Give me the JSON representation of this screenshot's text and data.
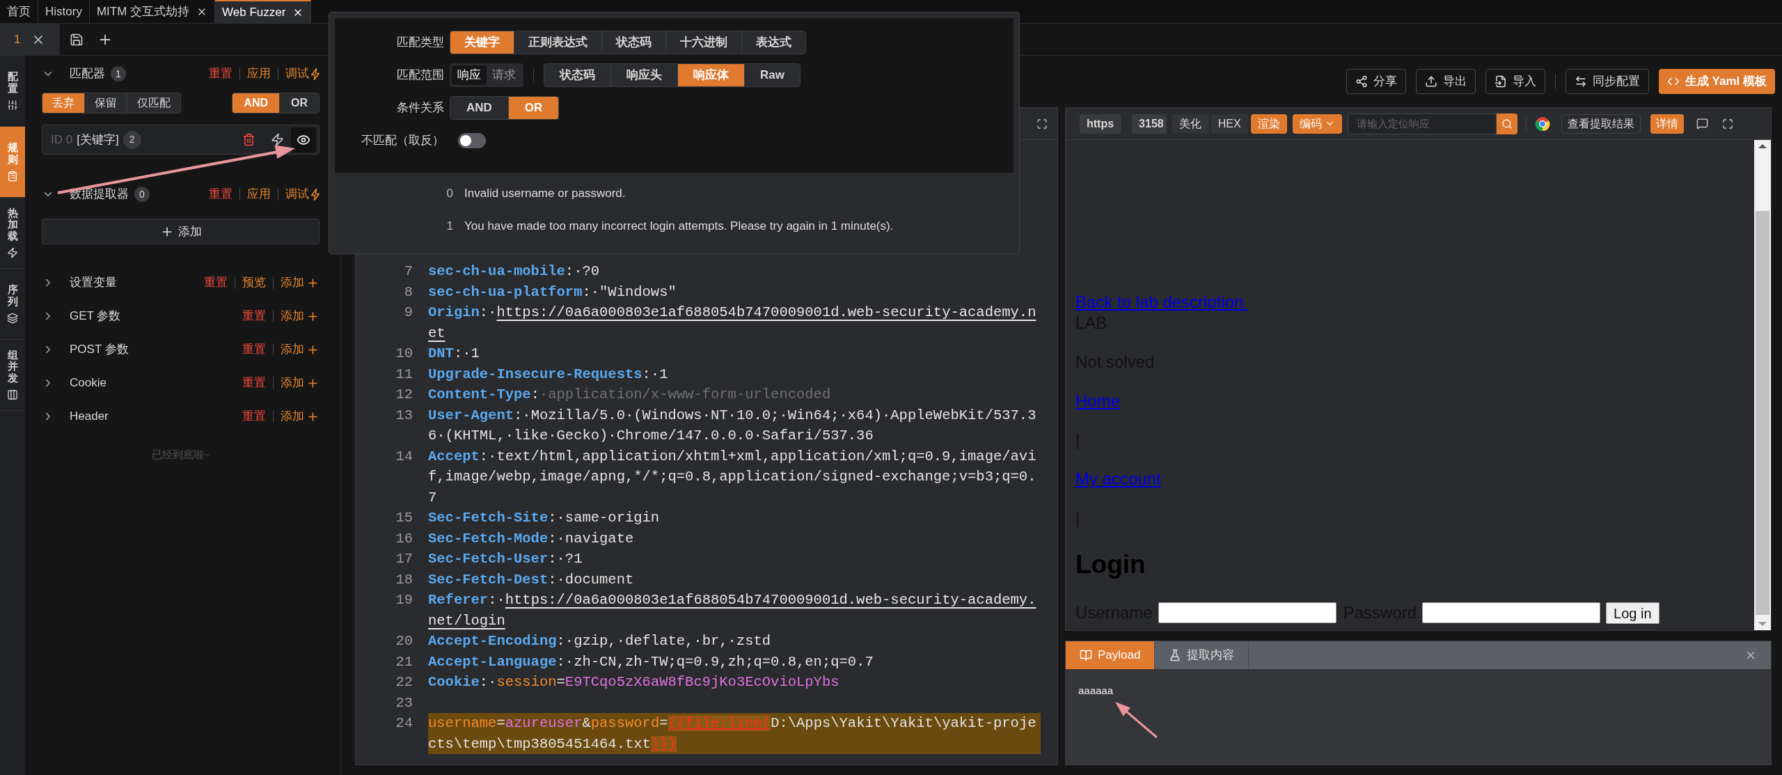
{
  "tabs": [
    {
      "label": "首页",
      "selected": false,
      "closable": false
    },
    {
      "label": "History",
      "selected": false,
      "closable": false
    },
    {
      "label": "MITM 交互式劫持",
      "selected": false,
      "closable": true
    },
    {
      "label": "Web Fuzzer",
      "selected": true,
      "closable": true
    }
  ],
  "sub_tab": {
    "label": "1"
  },
  "side_nav": [
    {
      "label": "配置",
      "selected": false
    },
    {
      "label": "规则",
      "selected": true
    },
    {
      "label": "热加载",
      "selected": false
    },
    {
      "label": "序列",
      "selected": false
    },
    {
      "label": "组并发",
      "selected": false
    }
  ],
  "matchers": {
    "title": "匹配器",
    "count": "1",
    "actions": [
      {
        "label": "重置",
        "kind": "danger"
      },
      {
        "label": "应用",
        "kind": "normal"
      },
      {
        "label": "调试",
        "kind": "debug"
      }
    ],
    "modes": [
      {
        "label": "丢弃",
        "selected": true
      },
      {
        "label": "保留",
        "selected": false
      },
      {
        "label": "仅匹配",
        "selected": false
      }
    ],
    "logic": [
      {
        "label": "AND",
        "selected": true
      },
      {
        "label": "OR",
        "selected": false
      }
    ],
    "items": [
      {
        "id": "ID 0",
        "type": "[关键字]",
        "count": "2"
      }
    ]
  },
  "extractors": {
    "title": "数据提取器",
    "count": "0",
    "actions": [
      {
        "label": "重置",
        "kind": "danger"
      },
      {
        "label": "应用",
        "kind": "normal"
      },
      {
        "label": "调试",
        "kind": "debug"
      }
    ],
    "add_button": "添加"
  },
  "sections": [
    {
      "title": "设置变量",
      "actions": [
        {
          "label": "重置",
          "kind": "danger"
        },
        {
          "label": "预览",
          "kind": "normal"
        },
        {
          "label": "添加",
          "kind": "add"
        }
      ]
    },
    {
      "title": "GET 参数",
      "actions": [
        {
          "label": "重置",
          "kind": "danger"
        },
        {
          "label": "添加",
          "kind": "add"
        }
      ]
    },
    {
      "title": "POST 参数",
      "actions": [
        {
          "label": "重置",
          "kind": "danger"
        },
        {
          "label": "添加",
          "kind": "add"
        }
      ]
    },
    {
      "title": "Cookie",
      "actions": [
        {
          "label": "重置",
          "kind": "danger"
        },
        {
          "label": "添加",
          "kind": "add"
        }
      ]
    },
    {
      "title": "Header",
      "actions": [
        {
          "label": "重置",
          "kind": "danger"
        },
        {
          "label": "添加",
          "kind": "add"
        }
      ]
    }
  ],
  "end_note": "已经到底啦~",
  "popup": {
    "match_type": {
      "label": "匹配类型",
      "options": [
        {
          "label": "关键字",
          "selected": true
        },
        {
          "label": "正则表达式",
          "selected": false
        },
        {
          "label": "状态码",
          "selected": false
        },
        {
          "label": "十六进制",
          "selected": false
        },
        {
          "label": "表达式",
          "selected": false
        }
      ]
    },
    "match_scope": {
      "label": "匹配范围",
      "source": [
        {
          "label": "响应",
          "selected": true
        },
        {
          "label": "请求",
          "selected": false
        }
      ],
      "options": [
        {
          "label": "状态码",
          "selected": false
        },
        {
          "label": "响应头",
          "selected": false
        },
        {
          "label": "响应体",
          "selected": true
        },
        {
          "label": "Raw",
          "selected": false
        }
      ]
    },
    "condition": {
      "label": "条件关系",
      "options": [
        {
          "label": "AND",
          "selected": false
        },
        {
          "label": "OR",
          "selected": true
        }
      ]
    },
    "negate": {
      "label": "不匹配（取反）",
      "on": false
    },
    "keywords": [
      {
        "index": "0",
        "text": "Invalid username or password."
      },
      {
        "index": "1",
        "text": "You have made too many incorrect login attempts. Please try again in 1 minute(s)."
      }
    ]
  },
  "toolbar": [
    {
      "label": "分享",
      "kind": "plain"
    },
    {
      "label": "导出",
      "kind": "plain"
    },
    {
      "label": "导入",
      "kind": "plain"
    },
    {
      "label": "同步配置",
      "kind": "plain"
    },
    {
      "label": "生成 Yaml 模板",
      "kind": "primary"
    }
  ],
  "editor_lines": [
    {
      "number": "7",
      "highlighted": false,
      "segments": [
        {
          "kind": "key",
          "text": "sec-ch-ua-mobile"
        },
        {
          "kind": "plain",
          "text": ":·?0"
        }
      ]
    },
    {
      "number": "8",
      "highlighted": false,
      "segments": [
        {
          "kind": "key",
          "text": "sec-ch-ua-platform"
        },
        {
          "kind": "plain",
          "text": ":·\"Windows\""
        }
      ]
    },
    {
      "number": "9",
      "highlighted": false,
      "segments": [
        {
          "kind": "key",
          "text": "Origin"
        },
        {
          "kind": "plain",
          "text": ":·"
        },
        {
          "kind": "url",
          "text": "https://0a6a000803e1af688054b7470009001d.web-security-academy.net"
        }
      ]
    },
    {
      "number": "10",
      "highlighted": false,
      "segments": [
        {
          "kind": "key",
          "text": "DNT"
        },
        {
          "kind": "plain",
          "text": ":·1"
        }
      ]
    },
    {
      "number": "11",
      "highlighted": false,
      "segments": [
        {
          "kind": "key",
          "text": "Upgrade-Insecure-Requests"
        },
        {
          "kind": "plain",
          "text": ":·1"
        }
      ]
    },
    {
      "number": "12",
      "highlighted": false,
      "segments": [
        {
          "kind": "key",
          "text": "Content-Type"
        },
        {
          "kind": "plain",
          "text": ":"
        },
        {
          "kind": "dim",
          "text": "·application/x-www-form-urlencoded"
        }
      ]
    },
    {
      "number": "13",
      "highlighted": false,
      "segments": [
        {
          "kind": "key",
          "text": "User-Agent"
        },
        {
          "kind": "plain",
          "text": ":·Mozilla/5.0·(Windows·NT·10.0;·Win64;·x64)·AppleWebKit/537.36·(KHTML,·like·Gecko)·Chrome/147.0.0.0·Safari/537.36"
        }
      ]
    },
    {
      "number": "14",
      "highlighted": false,
      "segments": [
        {
          "kind": "key",
          "text": "Accept"
        },
        {
          "kind": "plain",
          "text": ":·text/html,application/xhtml+xml,application/xml;q=0.9,image/avif,image/webp,image/apng,*/*;q=0.8,application/signed-exchange;v=b3;q=0.7"
        }
      ]
    },
    {
      "number": "15",
      "highlighted": false,
      "segments": [
        {
          "kind": "key",
          "text": "Sec-Fetch-Site"
        },
        {
          "kind": "plain",
          "text": ":·same-origin"
        }
      ]
    },
    {
      "number": "16",
      "highlighted": false,
      "segments": [
        {
          "kind": "key",
          "text": "Sec-Fetch-Mode"
        },
        {
          "kind": "plain",
          "text": ":·navigate"
        }
      ]
    },
    {
      "number": "17",
      "highlighted": false,
      "segments": [
        {
          "kind": "key",
          "text": "Sec-Fetch-User"
        },
        {
          "kind": "plain",
          "text": ":·?1"
        }
      ]
    },
    {
      "number": "18",
      "highlighted": false,
      "segments": [
        {
          "kind": "key",
          "text": "Sec-Fetch-Dest"
        },
        {
          "kind": "plain",
          "text": ":·document"
        }
      ]
    },
    {
      "number": "19",
      "highlighted": false,
      "segments": [
        {
          "kind": "key",
          "text": "Referer"
        },
        {
          "kind": "plain",
          "text": ":·"
        },
        {
          "kind": "url",
          "text": "https://0a6a000803e1af688054b7470009001d.web-security-academy.net/login"
        }
      ]
    },
    {
      "number": "20",
      "highlighted": false,
      "segments": [
        {
          "kind": "key",
          "text": "Accept-Encoding"
        },
        {
          "kind": "plain",
          "text": ":·gzip,·deflate,·br,·zstd"
        }
      ]
    },
    {
      "number": "21",
      "highlighted": false,
      "segments": [
        {
          "kind": "key",
          "text": "Accept-Language"
        },
        {
          "kind": "plain",
          "text": ":·zh-CN,zh-TW;q=0.9,zh;q=0.8,en;q=0.7"
        }
      ]
    },
    {
      "number": "22",
      "highlighted": false,
      "segments": [
        {
          "kind": "key",
          "text": "Cookie"
        },
        {
          "kind": "plain",
          "text": ":·"
        },
        {
          "kind": "param",
          "text": "session"
        },
        {
          "kind": "plain",
          "text": "="
        },
        {
          "kind": "value",
          "text": "E9TCqo5zX6aW8fBc9jKo3EcOvioLpYbs"
        }
      ]
    },
    {
      "number": "23",
      "highlighted": false
    },
    {
      "number": "24",
      "highlighted": true,
      "segments": [
        {
          "kind": "param",
          "text": "username"
        },
        {
          "kind": "plain",
          "text": "="
        },
        {
          "kind": "value",
          "text": "azureuser"
        },
        {
          "kind": "plain",
          "text": "&"
        },
        {
          "kind": "param",
          "text": "password"
        },
        {
          "kind": "plain",
          "text": "="
        },
        {
          "kind": "tag",
          "text": "{{file:line"
        },
        {
          "kind": "tag",
          "text": "("
        },
        {
          "kind": "plain",
          "text": "D:\\Apps\\Yakit\\Yakit\\yakit-projects\\temp\\tmp3805451464.txt"
        },
        {
          "kind": "tag",
          "text": ")}}"
        }
      ]
    }
  ],
  "response_toolbar": {
    "scheme": "https",
    "size": "3158",
    "view_modes": [
      {
        "label": "美化",
        "selected": false
      },
      {
        "label": "HEX",
        "selected": false
      },
      {
        "label": "渲染",
        "selected": true
      }
    ],
    "encoding": "编码",
    "search_placeholder": "请输入定位响应",
    "view_extract": "查看提取结果",
    "details": "详情"
  },
  "rendered_page": [
    {
      "kind": "top-link",
      "text": "Back to lab description "
    },
    {
      "kind": "label",
      "text": "LAB"
    },
    {
      "kind": "text",
      "text": "Not solved"
    },
    {
      "kind": "link",
      "text": "Home"
    },
    {
      "kind": "text",
      "text": "|"
    },
    {
      "kind": "link",
      "text": "My account"
    },
    {
      "kind": "text",
      "text": "|"
    },
    {
      "kind": "heading",
      "text": "Login"
    }
  ],
  "login_form": {
    "username_label": "Username",
    "password_label": "Password",
    "submit": "Log in"
  },
  "bottom_tabs": [
    {
      "label": "Payload",
      "selected": true
    },
    {
      "label": "提取内容",
      "selected": false
    }
  ],
  "payload": "aaaaaa"
}
